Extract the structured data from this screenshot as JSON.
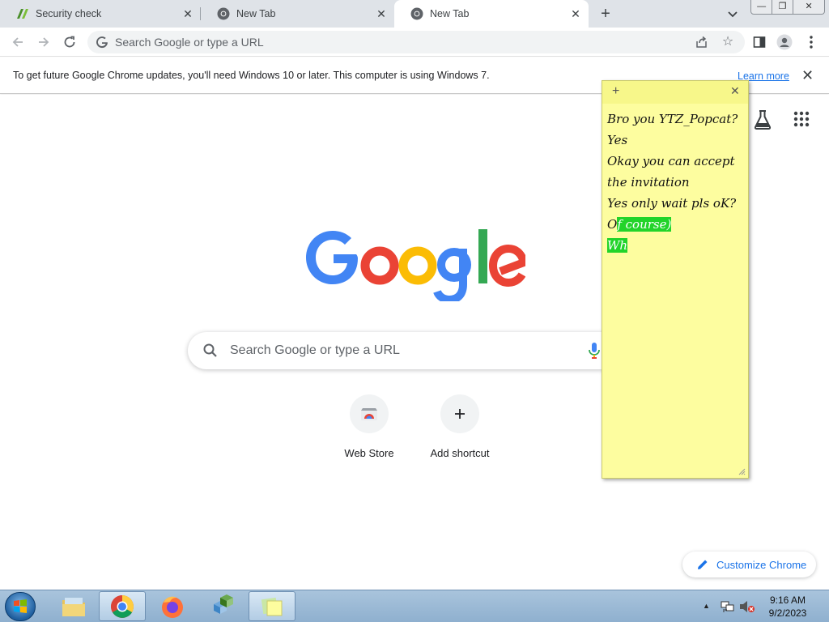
{
  "tabs": [
    {
      "title": "Security check",
      "icon": "security-check-favicon",
      "active": false
    },
    {
      "title": "New Tab",
      "icon": "chrome-favicon",
      "active": false
    },
    {
      "title": "New Tab",
      "icon": "chrome-favicon",
      "active": true
    }
  ],
  "tabstrip": {
    "new_tab": "+",
    "tab_close": "✕"
  },
  "window_controls": {
    "minimize": "—",
    "restore": "❐",
    "close": "✕"
  },
  "omnibox": {
    "placeholder": "Search Google or type a URL"
  },
  "infobar": {
    "message": "To get future Google Chrome updates, you'll need Windows 10 or later. This computer is using Windows 7.",
    "link": "Learn more",
    "close": "✕"
  },
  "ntp": {
    "search_placeholder": "Search Google or type a URL",
    "shortcuts": [
      {
        "label": "Web Store",
        "icon": "web-store-icon"
      },
      {
        "label": "Add shortcut",
        "icon": "plus-icon"
      }
    ],
    "customize_label": "Customize Chrome"
  },
  "sticky_note": {
    "add": "+",
    "close": "✕",
    "lines": [
      {
        "plain": "Bro you YTZ_Popcat?",
        "highlight": ""
      },
      {
        "plain": "Yes",
        "highlight": ""
      },
      {
        "plain": "Okay you can accept",
        "highlight": ""
      },
      {
        "plain": "the invitation",
        "highlight": ""
      },
      {
        "plain": "Yes only wait pls oK?",
        "highlight": ""
      },
      {
        "plain": "O",
        "highlight": "f course)"
      },
      {
        "plain": "",
        "highlight": "Wh"
      }
    ]
  },
  "taskbar": {
    "apps": [
      "file-explorer-icon",
      "chrome-icon",
      "firefox-icon",
      "registry-editor-icon",
      "sticky-notes-icon"
    ],
    "time": "9:16 AM",
    "date": "9/2/2023"
  },
  "colors": {
    "highlight": "#22d42a",
    "sticky_bg": "#fdfd9f",
    "link": "#1a73e8"
  }
}
